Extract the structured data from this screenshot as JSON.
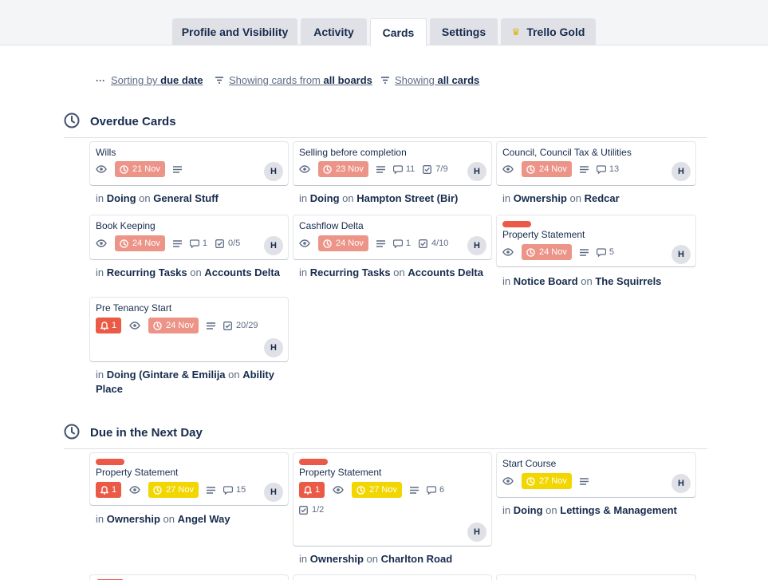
{
  "tabs": [
    {
      "label": "Profile and Visibility"
    },
    {
      "label": "Activity"
    },
    {
      "label": "Cards"
    },
    {
      "label": "Settings"
    },
    {
      "label": "Trello Gold"
    }
  ],
  "filters": {
    "sort_prefix": "Sorting by ",
    "sort_value": "due date",
    "boards_prefix": "Showing cards from ",
    "boards_value": "all boards",
    "cards_prefix": "Showing ",
    "cards_value": "all cards"
  },
  "sections": {
    "overdue": {
      "title": "Overdue Cards"
    },
    "next_day": {
      "title": "Due in the Next Day"
    }
  },
  "common": {
    "in": "in ",
    "on": " on "
  },
  "cards": [
    {
      "title": "Wills",
      "due": "21 Nov",
      "avatar": "H",
      "list": "Doing",
      "board": "General Stuff"
    },
    {
      "title": "Selling before completion",
      "due": "23 Nov",
      "comments": "11",
      "checklist": "7/9",
      "avatar": "H",
      "list": "Doing",
      "board": "Hampton Street (Bir)"
    },
    {
      "title": "Council, Council Tax & Utilities",
      "due": "24 Nov",
      "comments": "13",
      "avatar": "H",
      "list": "Ownership",
      "board": "Redcar"
    },
    {
      "title": "Book Keeping",
      "due": "24 Nov",
      "comments": "1",
      "checklist": "0/5",
      "avatar": "H",
      "list": "Recurring Tasks",
      "board": "Accounts Delta"
    },
    {
      "title": "Cashflow Delta",
      "due": "24 Nov",
      "comments": "1",
      "checklist": "4/10",
      "avatar": "H",
      "list": "Recurring Tasks",
      "board": "Accounts Delta"
    },
    {
      "title": "Property Statement",
      "due": "24 Nov",
      "comments": "5",
      "avatar": "H",
      "list": "Notice Board",
      "board": "The Squirrels"
    },
    {
      "title": "Pre Tenancy Start",
      "bell": "1",
      "due": "24 Nov",
      "checklist": "20/29",
      "avatar": "H",
      "list": "Doing (Gintare & Emilija",
      "board": "Ability Place"
    },
    {
      "title": "Property Statement",
      "bell": "1",
      "due": "27 Nov",
      "comments": "15",
      "avatar": "H",
      "list": "Ownership",
      "board": "Angel Way"
    },
    {
      "title": "Property Statement",
      "bell": "1",
      "due": "27 Nov",
      "comments": "6",
      "checklist": "1/2",
      "avatar": "H",
      "list": "Ownership",
      "board": "Charlton Road"
    },
    {
      "title": "Start Course",
      "due": "27 Nov",
      "avatar": "H",
      "list": "Doing",
      "board": "Lettings & Management"
    }
  ],
  "colors": {
    "overdue_due": "#ec9488",
    "soon_due": "#f2d600",
    "label_red": "#eb5a46",
    "bell_red": "#eb5a46",
    "gold_crown": "#e2b203"
  }
}
